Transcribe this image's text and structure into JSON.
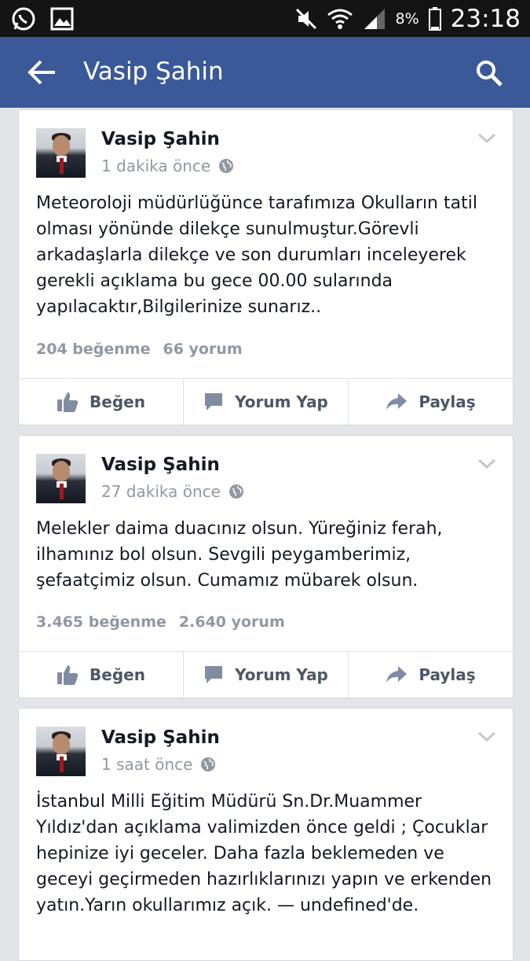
{
  "status_bar": {
    "battery_percent": "8%",
    "time": "23:18",
    "icons": [
      "whatsapp-icon",
      "image-icon",
      "mute-icon",
      "wifi-icon",
      "signal-icon",
      "battery-icon"
    ]
  },
  "app_bar": {
    "title": "Vasip Şahin",
    "back_icon": "arrow-left-icon",
    "search_icon": "search-icon"
  },
  "colors": {
    "app_bar": "#3b5998",
    "background": "#e3e4e8",
    "muted_text": "#9197a3"
  },
  "posts": [
    {
      "author": "Vasip Şahin",
      "time": "1 dakika önce",
      "text": "Meteoroloji müdürlüğünce tarafımıza Okulların tatil olması yönünde dilekçe sunulmuştur.Görevli arkadaşlarla dilekçe ve son durumları inceleyerek gerekli açıklama bu gece 00.00 sularında yapılacaktır,Bilgilerinize sunarız..",
      "likes": "204 beğenme",
      "comments": "66 yorum"
    },
    {
      "author": "Vasip Şahin",
      "time": "27 dakika önce",
      "text": "Melekler daima duacınız olsun. Yüreğiniz ferah, ilhamınız bol olsun. Sevgili peygamberimiz, şefaatçimiz olsun. Cumamız mübarek olsun.",
      "likes": "3.465 beğenme",
      "comments": "2.640 yorum"
    },
    {
      "author": "Vasip Şahin",
      "time": "1 saat önce",
      "text": "İstanbul Milli Eğitim Müdürü Sn.Dr.Muammer Yıldız'dan açıklama valimizden önce geldi ; Çocuklar hepinize iyi geceler. Daha fazla beklemeden ve geceyi geçirmeden hazırlıklarınızı yapın ve erkenden yatın.Yarın okullarımız açık. — undefined'de."
    }
  ],
  "actions": {
    "like": "Beğen",
    "comment": "Yorum Yap",
    "share": "Paylaş"
  }
}
